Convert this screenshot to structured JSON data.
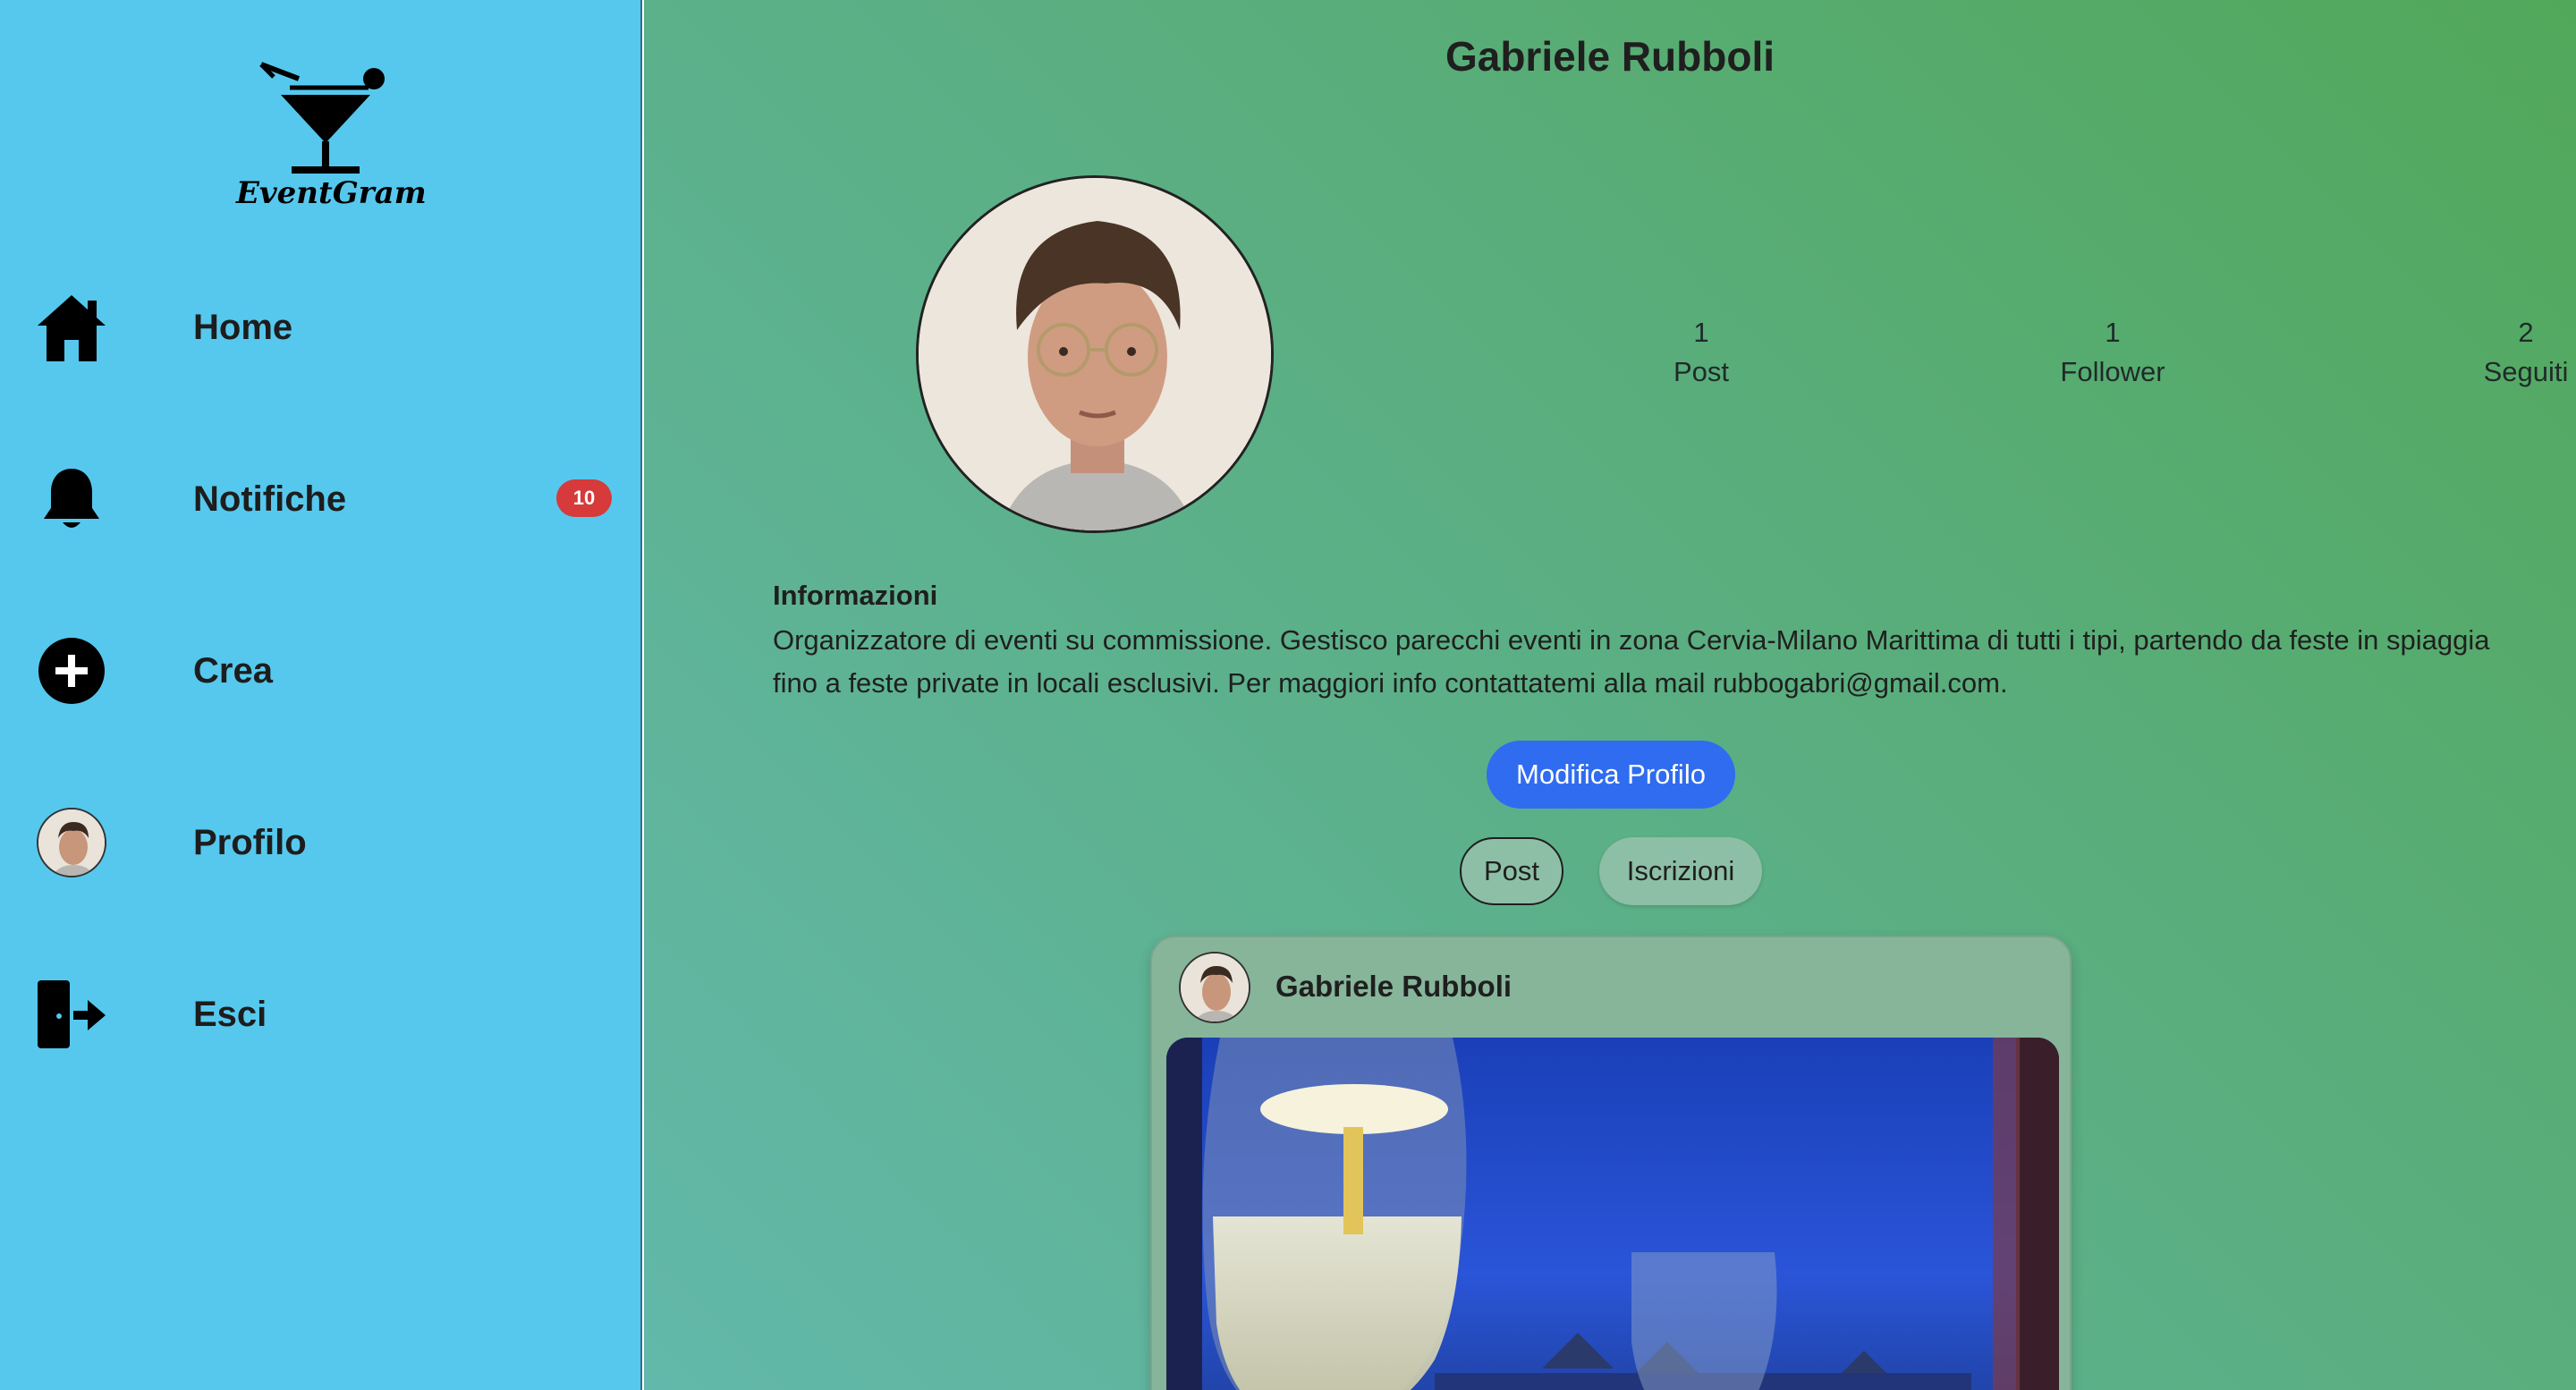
{
  "app": {
    "logo_text": "EventGram"
  },
  "sidebar": {
    "items": [
      {
        "label": "Home",
        "icon": "home-icon"
      },
      {
        "label": "Notifiche",
        "icon": "bell-icon",
        "badge": "10"
      },
      {
        "label": "Crea",
        "icon": "plus-circle-icon"
      },
      {
        "label": "Profilo",
        "icon": "avatar"
      },
      {
        "label": "Esci",
        "icon": "logout-icon"
      }
    ]
  },
  "profile": {
    "name": "Gabriele Rubboli",
    "stats": [
      {
        "value": "1",
        "label": "Post"
      },
      {
        "value": "1",
        "label": "Follower"
      },
      {
        "value": "2",
        "label": "Seguiti"
      }
    ],
    "info_title": "Informazioni",
    "info_text": "Organizzatore di eventi su commissione. Gestisco parecchi eventi in zona Cervia-Milano Marittima di tutti i tipi, partendo da feste in spiaggia fino a feste private in locali esclusivi. Per maggiori info contattatemi alla mail rubbogabri@gmail.com.",
    "edit_button": "Modifica Profilo",
    "tabs": [
      {
        "label": "Post"
      },
      {
        "label": "Iscrizioni"
      }
    ]
  },
  "post": {
    "author": "Gabriele Rubboli"
  },
  "colors": {
    "sidebar_bg": "#56c8ee",
    "badge": "#d63a3a",
    "primary_button": "#2f6cf0"
  }
}
